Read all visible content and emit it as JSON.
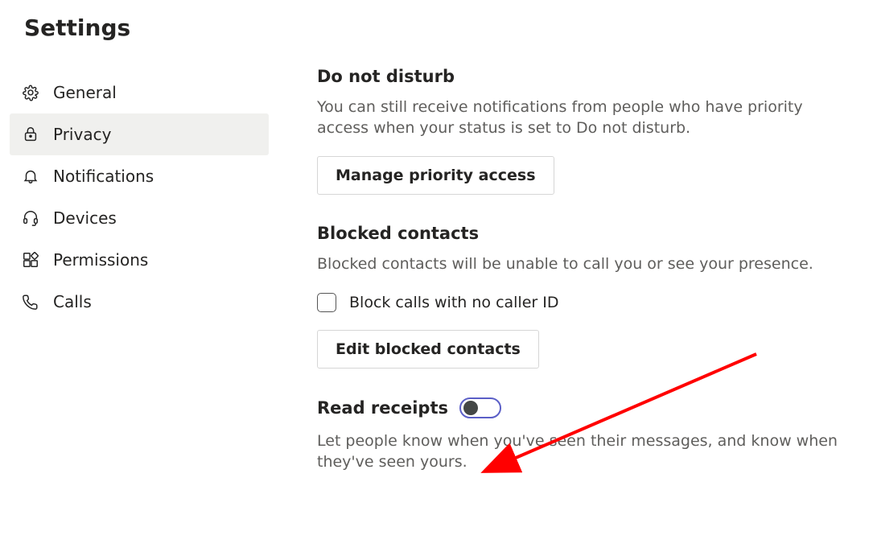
{
  "title": "Settings",
  "sidebar": {
    "items": [
      {
        "label": "General"
      },
      {
        "label": "Privacy"
      },
      {
        "label": "Notifications"
      },
      {
        "label": "Devices"
      },
      {
        "label": "Permissions"
      },
      {
        "label": "Calls"
      }
    ],
    "active_index": 1
  },
  "sections": {
    "dnd": {
      "title": "Do not disturb",
      "desc": "You can still receive notifications from people who have priority access when your status is set to Do not disturb.",
      "button": "Manage priority access"
    },
    "blocked": {
      "title": "Blocked contacts",
      "desc": "Blocked contacts will be unable to call you or see your presence.",
      "checkbox_label": "Block calls with no caller ID",
      "checkbox_checked": false,
      "button": "Edit blocked contacts"
    },
    "read_receipts": {
      "title": "Read receipts",
      "toggle_on": false,
      "desc": "Let people know when you've seen their messages, and know when they've seen yours."
    }
  },
  "annotation": {
    "arrow_color": "#ff0000"
  }
}
